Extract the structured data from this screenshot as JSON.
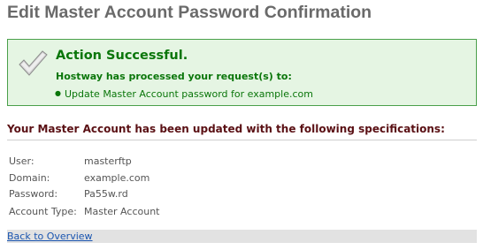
{
  "page": {
    "title": "Edit Master Account Password Confirmation"
  },
  "success": {
    "icon": "checkmark-icon",
    "title": "Action Successful.",
    "subtitle": "Hostway has processed your request(s) to:",
    "items": [
      "Update Master Account password for example.com"
    ],
    "colors": {
      "background": "#e5f5e3",
      "border": "#4aa04a",
      "text": "#0a760a"
    }
  },
  "specs": {
    "heading": "Your Master Account has been updated with the following specifications:",
    "rows": [
      {
        "label": "User:",
        "value": "masterftp"
      },
      {
        "label": "Domain:",
        "value": "example.com"
      },
      {
        "label": "Password:",
        "value": "Pa55w.rd"
      },
      {
        "label": "Account Type:",
        "value": "Master Account"
      }
    ]
  },
  "footer": {
    "back_link": "Back to Overview"
  }
}
